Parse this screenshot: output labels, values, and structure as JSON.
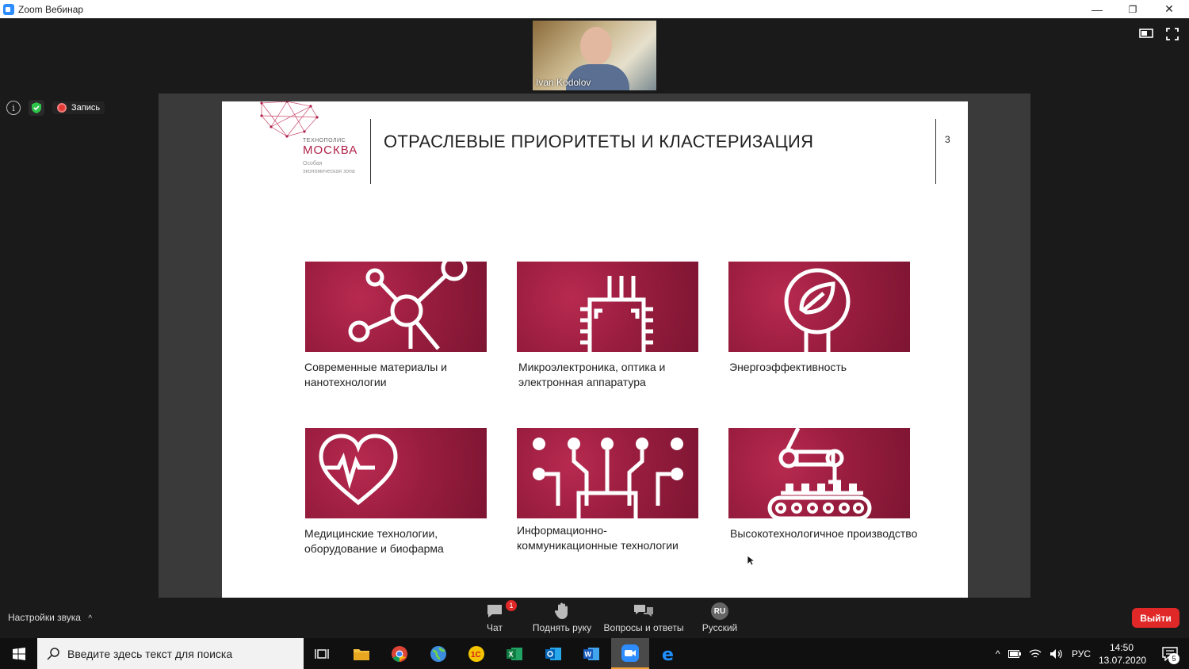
{
  "window": {
    "title": "Zoom Вебинар",
    "minimize": "—",
    "restore": "❐",
    "close": "✕"
  },
  "video": {
    "participant_name": "Ivan Kodolov"
  },
  "status": {
    "info": "i",
    "record_label": "Запись"
  },
  "slide": {
    "logo_small": "ТЕХНОПОЛИС",
    "logo_main": "МОСКВА",
    "logo_sub": "Особая экономическая зона",
    "heading": "ОТРАСЛЕВЫЕ ПРИОРИТЕТЫ И  КЛАСТЕРИЗАЦИЯ",
    "page_number": "3",
    "tiles": [
      {
        "icon": "molecule-icon",
        "caption": "Современные материалы и нанотехнологии"
      },
      {
        "icon": "chip-icon",
        "caption": "Микроэлектроника, оптика и электронная аппаратура"
      },
      {
        "icon": "eco-bulb-icon",
        "caption": "Энергоэффективность"
      },
      {
        "icon": "heart-pulse-icon",
        "caption": "Медицинские технологии, оборудование и биофарма"
      },
      {
        "icon": "network-icon",
        "caption": "Информационно-коммуникационные технологии"
      },
      {
        "icon": "robot-arm-icon",
        "caption": "Высокотехнологичное производство"
      }
    ]
  },
  "toolbar": {
    "audio_settings": "Настройки звука",
    "chat": "Чат",
    "chat_badge": "1",
    "raise_hand": "Поднять руку",
    "qa": "Вопросы и ответы",
    "language": "Русский",
    "language_code": "RU",
    "leave": "Выйти"
  },
  "taskbar": {
    "search_placeholder": "Введите здесь текст для поиска",
    "language": "РУС",
    "time": "14:50",
    "date": "13.07.2020",
    "notifications": "5"
  },
  "colors": {
    "brand": "#b0224a",
    "tile": "#9a1d3f",
    "leave": "#e02828",
    "accent_zoom": "#2d8cff"
  }
}
